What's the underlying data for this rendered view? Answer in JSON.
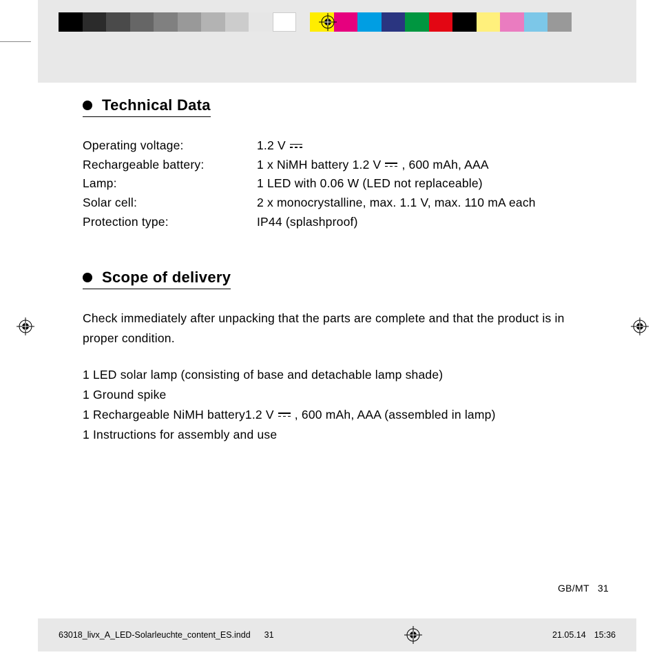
{
  "colorbar": [
    "#000000",
    "#2b2b2b",
    "#4a4a4a",
    "#666666",
    "#808080",
    "#999999",
    "#b3b3b3",
    "#cccccc",
    "#e6e6e6",
    "#ffffff",
    "",
    "#ffed00",
    "#e6007e",
    "#009ee3",
    "#2a3580",
    "#009640",
    "#e30613",
    "#000000",
    "#fff07c",
    "#ea7cc0",
    "#7cc7e8",
    "#999999"
  ],
  "sections": {
    "technical": {
      "heading": "Technical Data",
      "rows": [
        {
          "label": "Operating voltage:",
          "value_pre": "1.2 V",
          "dc": true,
          "value_post": ""
        },
        {
          "label": "Rechargeable battery:",
          "value_pre": "1 x NiMH battery 1.2 V",
          "dc": true,
          "value_post": ", 600 mAh, AAA"
        },
        {
          "label": "Lamp:",
          "value_pre": "1 LED with 0.06 W (LED not replaceable)",
          "dc": false,
          "value_post": ""
        },
        {
          "label": "Solar cell:",
          "value_pre": "2 x monocrystalline, max. 1.1 V, max. 110 mA each",
          "dc": false,
          "value_post": ""
        },
        {
          "label": "Protection type:",
          "value_pre": "IP44 (splashproof)",
          "dc": false,
          "value_post": ""
        }
      ]
    },
    "scope": {
      "heading": "Scope of delivery",
      "para": "Check immediately after unpacking that the parts are complete and that the product is in proper condition.",
      "items": [
        {
          "pre": "1 LED solar lamp (consisting of base and detachable lamp shade)",
          "dc": false,
          "post": ""
        },
        {
          "pre": "1 Ground spike",
          "dc": false,
          "post": ""
        },
        {
          "pre": "1 Rechargeable NiMH battery1.2 V",
          "dc": true,
          "post": ", 600 mAh, AAA (assembled in lamp)"
        },
        {
          "pre": "1 Instructions for assembly and use",
          "dc": false,
          "post": ""
        }
      ]
    }
  },
  "page_marker": {
    "lang": "GB/MT",
    "num": "31"
  },
  "footer": {
    "file": "63018_livx_A_LED-Solarleuchte_content_ES.indd",
    "filepage": "31",
    "date": "21.05.14",
    "time": "15:36"
  }
}
